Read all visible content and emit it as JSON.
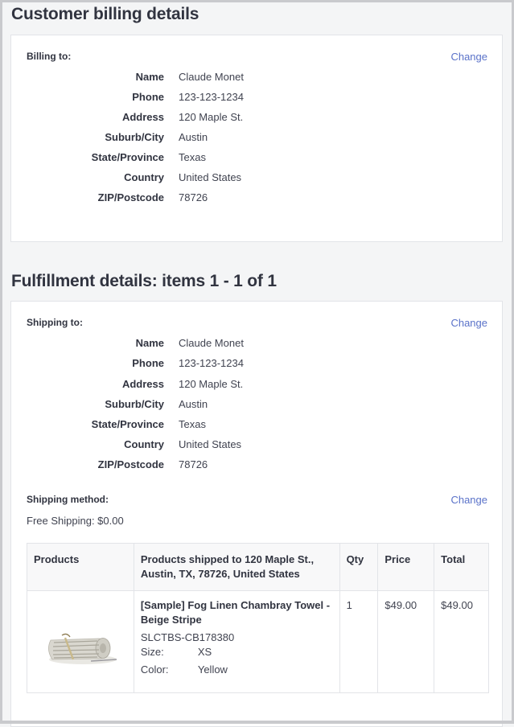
{
  "billing": {
    "heading": "Customer billing details",
    "label": "Billing to:",
    "change": "Change",
    "fields": [
      {
        "key": "Name",
        "value": "Claude Monet"
      },
      {
        "key": "Phone",
        "value": "123-123-1234"
      },
      {
        "key": "Address",
        "value": "120 Maple St."
      },
      {
        "key": "Suburb/City",
        "value": "Austin"
      },
      {
        "key": "State/Province",
        "value": "Texas"
      },
      {
        "key": "Country",
        "value": "United States"
      },
      {
        "key": "ZIP/Postcode",
        "value": "78726"
      }
    ]
  },
  "fulfillment": {
    "heading": "Fulfillment details: items 1 - 1 of 1",
    "label": "Shipping to:",
    "change": "Change",
    "fields": [
      {
        "key": "Name",
        "value": "Claude Monet"
      },
      {
        "key": "Phone",
        "value": "123-123-1234"
      },
      {
        "key": "Address",
        "value": "120 Maple St."
      },
      {
        "key": "Suburb/City",
        "value": "Austin"
      },
      {
        "key": "State/Province",
        "value": "Texas"
      },
      {
        "key": "Country",
        "value": "United States"
      },
      {
        "key": "ZIP/Postcode",
        "value": "78726"
      }
    ],
    "shipping_method": {
      "label": "Shipping method:",
      "change": "Change",
      "value": "Free Shipping: $0.00"
    },
    "table": {
      "headers": {
        "products": "Products",
        "shipped_to": "Products shipped to 120 Maple St., Austin, TX, 78726, United States",
        "qty": "Qty",
        "price": "Price",
        "total": "Total"
      },
      "rows": [
        {
          "image_icon": "rolled-towel-image",
          "name": "[Sample] Fog Linen Chambray Towel - Beige Stripe",
          "sku": "SLCTBS-CB178380",
          "options": [
            {
              "label": "Size:",
              "value": "XS"
            },
            {
              "label": "Color:",
              "value": "Yellow"
            }
          ],
          "qty": "1",
          "price": "$49.00",
          "total": "$49.00"
        }
      ]
    }
  },
  "colors": {
    "link": "#5a72c9",
    "text": "#313440",
    "page_bg": "#f4f5f6",
    "card_bg": "#ffffff",
    "border": "#e2e4e8"
  }
}
